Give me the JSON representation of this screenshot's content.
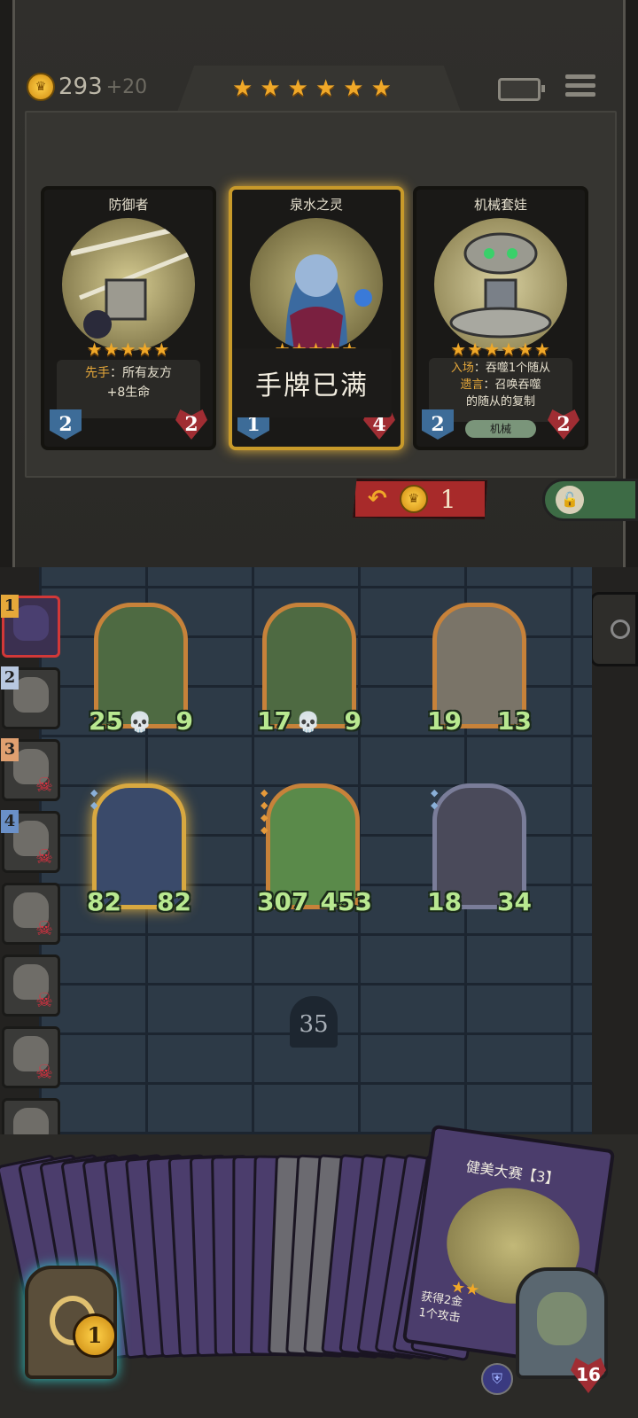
{
  "header": {
    "gold": "293",
    "gold_income": "+20",
    "tavern_stars": 6
  },
  "shop": {
    "cards": [
      {
        "name": "防御者",
        "stars": "★★★★★",
        "text_hl": "先手",
        "text": "：所有友方",
        "text2": "+8生命",
        "atk": "2",
        "hp": "2",
        "tribe": ""
      },
      {
        "name": "泉水之灵",
        "stars": "★★★★★",
        "atk": "1",
        "hp": "4",
        "overlay": "手牌已满"
      },
      {
        "name": "机械套娃",
        "stars": "★★★★★★",
        "line1_hl": "入场",
        "line1": "：吞噬1个随从",
        "line2_hl": "遗言",
        "line2": "：召唤吞噬",
        "line3": "的随从的复制",
        "atk": "2",
        "hp": "2",
        "tribe": "机械"
      }
    ],
    "refresh_cost": "1"
  },
  "opponents": [
    {
      "rank": "1",
      "active": true,
      "dead": false
    },
    {
      "rank": "2",
      "active": false,
      "dead": false
    },
    {
      "rank": "3",
      "active": false,
      "dead": true
    },
    {
      "rank": "4",
      "active": false,
      "dead": true
    },
    {
      "rank": "",
      "active": false,
      "dead": true
    },
    {
      "rank": "",
      "active": false,
      "dead": true
    },
    {
      "rank": "",
      "active": false,
      "dead": true
    },
    {
      "rank": "",
      "active": false,
      "dead": true
    }
  ],
  "board": {
    "minions": [
      {
        "atk": "25",
        "hp": "9"
      },
      {
        "atk": "17",
        "hp": "9"
      },
      {
        "atk": "19",
        "hp": "13"
      },
      {
        "atk": "82",
        "hp": "82"
      },
      {
        "atk": "307",
        "hp": "453"
      },
      {
        "atk": "18",
        "hp": "34"
      }
    ],
    "turn": "35"
  },
  "hand": {
    "card_title": "健美大赛【3】",
    "card_text1": "获得2金",
    "card_text2": "1个攻击"
  },
  "player": {
    "treasure_count": "1",
    "hero_hp": "16"
  },
  "colors": {
    "gold_star": "#f0a828",
    "attack_blue": "#3d6c98",
    "health_red": "#a02d33",
    "refresh_red": "#a82a2a"
  }
}
